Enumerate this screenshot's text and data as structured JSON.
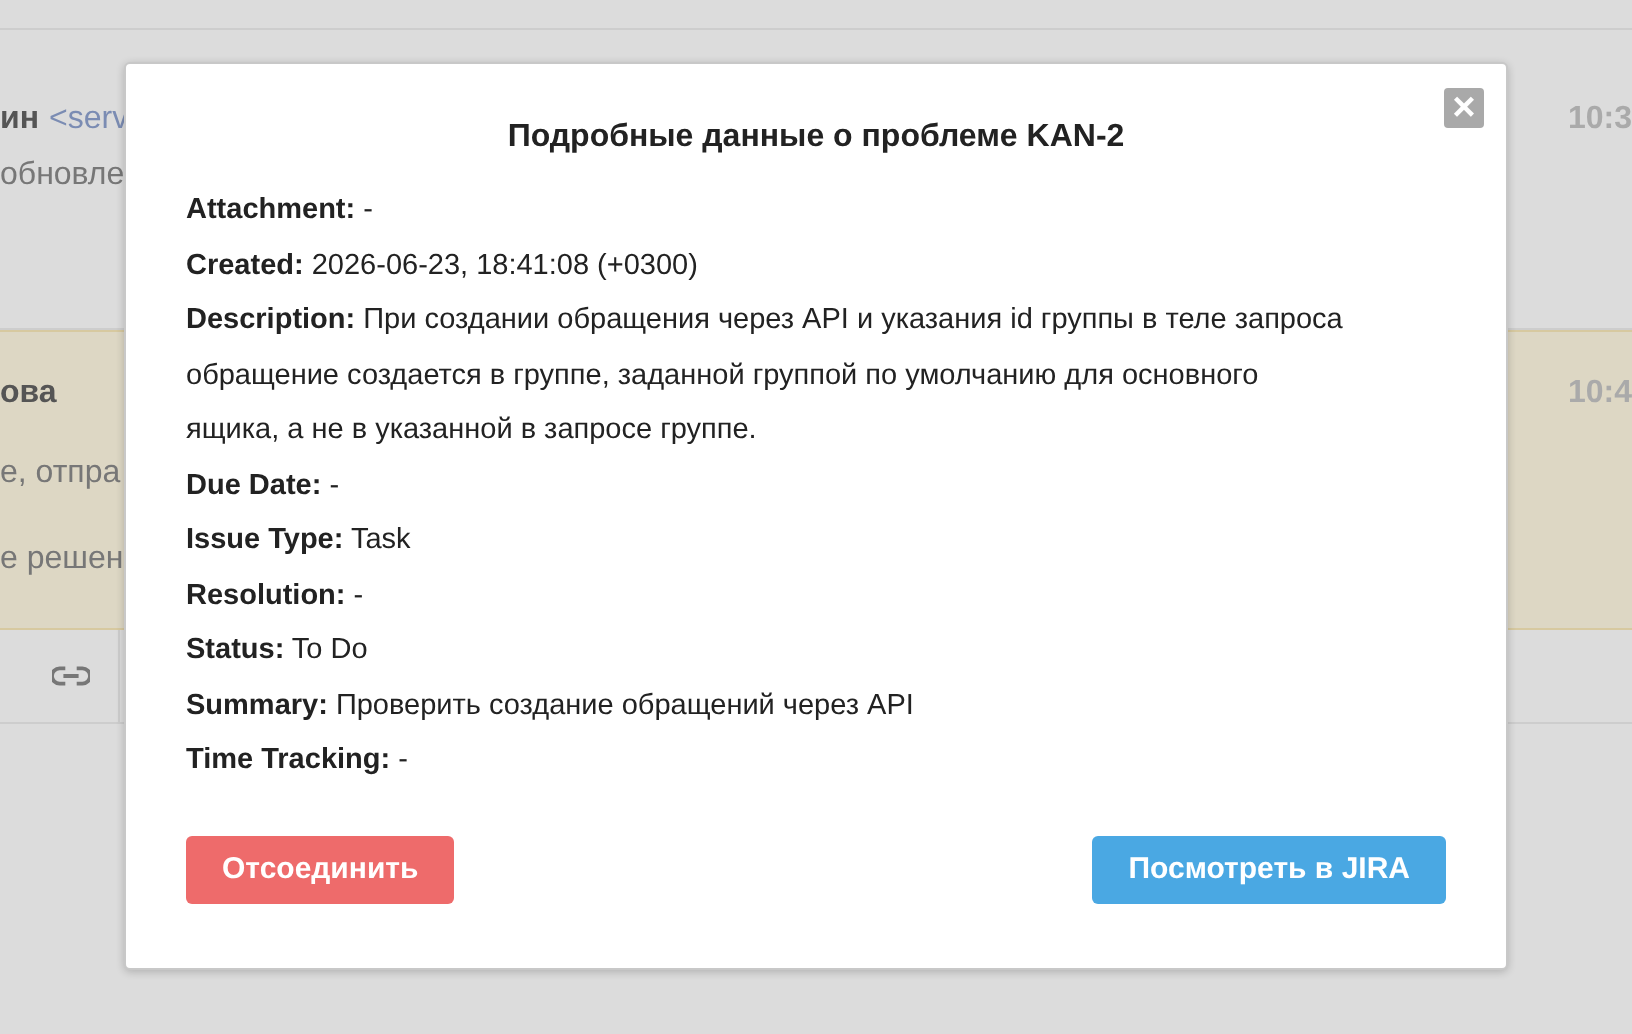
{
  "background": {
    "messages": [
      {
        "author": "ин",
        "email": "<serv",
        "time": "10:3",
        "lines": [
          "обновле"
        ],
        "highlighted": false
      },
      {
        "author": "ова",
        "time": "10:4",
        "lines": [
          "е, отпра",
          "е решен"
        ],
        "highlighted": true
      }
    ]
  },
  "modal": {
    "title": "Подробные данные о проблеме KAN-2",
    "close": "×",
    "fields": [
      "**Attachment:** -",
      "**Created:** 2026-06-23, 18:41:08 (+0300)",
      "**Description:** При создании обращения через API и указания id группы в теле запроса обращение создается в группе, заданной группой по умолчанию для основного ящика, а не в указанной в запросе группе.",
      "**Due Date:** -",
      "**Issue Type:** Task",
      "**Resolution:** -",
      "**Status:** To Do",
      "**Summary:** Проверить создание обращений через API",
      "**Time Tracking:** -"
    ],
    "buttons": [
      {
        "label": "Отсоединить",
        "kind": "danger"
      },
      {
        "label": "Посмотреть в JIRA",
        "kind": "primary"
      }
    ]
  }
}
